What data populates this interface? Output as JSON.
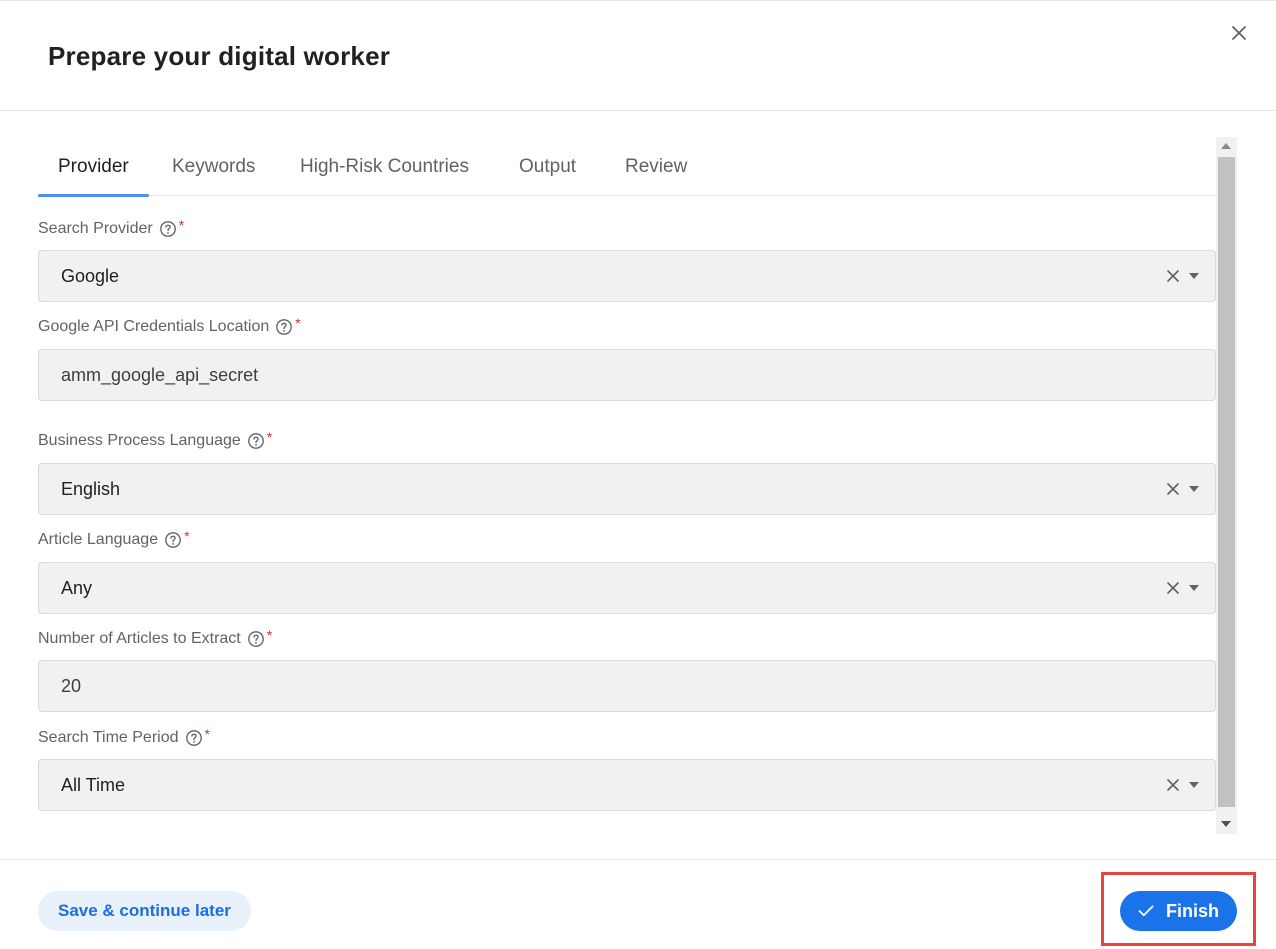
{
  "dialog": {
    "title": "Prepare your digital worker"
  },
  "tabs": [
    {
      "label": "Provider",
      "active": true
    },
    {
      "label": "Keywords",
      "active": false
    },
    {
      "label": "High-Risk Countries",
      "active": false
    },
    {
      "label": "Output",
      "active": false
    },
    {
      "label": "Review",
      "active": false
    }
  ],
  "fields": {
    "search_provider": {
      "label": "Search Provider",
      "required_mark": "*",
      "value": "Google",
      "type": "select"
    },
    "credentials": {
      "label": "Google API Credentials Location",
      "required_mark": "*",
      "value": "amm_google_api_secret",
      "type": "text"
    },
    "process_language": {
      "label": "Business Process Language",
      "required_mark": "*",
      "value": "English",
      "type": "select"
    },
    "article_language": {
      "label": "Article Language",
      "required_mark": "*",
      "value": "Any",
      "type": "select"
    },
    "num_articles": {
      "label": "Number of Articles to Extract",
      "required_mark": "*",
      "value": "20",
      "type": "number"
    },
    "time_period": {
      "label": "Search Time Period",
      "required_mark": "*",
      "value": "All Time",
      "type": "select"
    }
  },
  "footer": {
    "save_label": "Save & continue later",
    "finish_label": "Finish"
  },
  "colors": {
    "accent": "#1a73e8",
    "tab_indicator": "#4a8fe8",
    "required": "#d93025",
    "highlight": "#e84343",
    "field_bg": "#f1f1f1"
  },
  "icons": [
    "close-icon",
    "help-icon",
    "clear-icon",
    "chevron-down-icon",
    "check-icon",
    "scroll-up-icon",
    "scroll-down-icon"
  ]
}
